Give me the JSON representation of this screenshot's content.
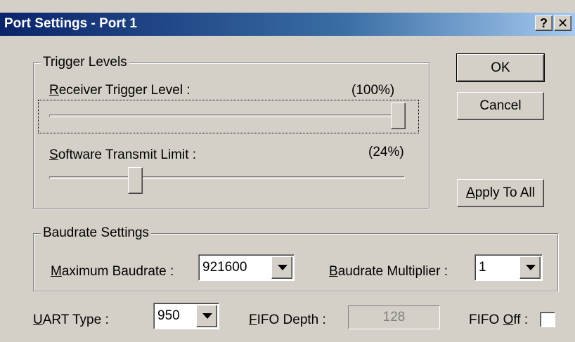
{
  "window": {
    "title": "Port Settings - Port 1",
    "help_glyph": "?",
    "close_glyph": "✕"
  },
  "trigger_levels": {
    "group_title": "Trigger Levels",
    "receiver": {
      "mnemonic": "R",
      "label_rest": "eceiver Trigger Level :",
      "value_text": "(100%)",
      "level_percent": 100
    },
    "software": {
      "mnemonic": "S",
      "label_rest": "oftware Transmit Limit :",
      "value_text": "(24%)",
      "level_percent": 24
    }
  },
  "buttons": {
    "ok": "OK",
    "cancel": "Cancel",
    "apply_mnemonic": "A",
    "apply_rest": "pply To All"
  },
  "baudrate": {
    "group_title": "Baudrate Settings",
    "max_mnemonic": "M",
    "max_rest": "aximum Baudrate :",
    "max_value": "921600",
    "mult_mnemonic": "B",
    "mult_rest": "audrate Multiplier :",
    "mult_value": "1"
  },
  "uart": {
    "mnemonic": "U",
    "label_rest": "ART Type :",
    "value": "950"
  },
  "fifo": {
    "depth_mnemonic": "F",
    "depth_rest": "IFO Depth :",
    "depth_value": "128",
    "off_prefix": "FIFO ",
    "off_mnemonic": "O",
    "off_rest": "ff :",
    "off_checked": false
  }
}
